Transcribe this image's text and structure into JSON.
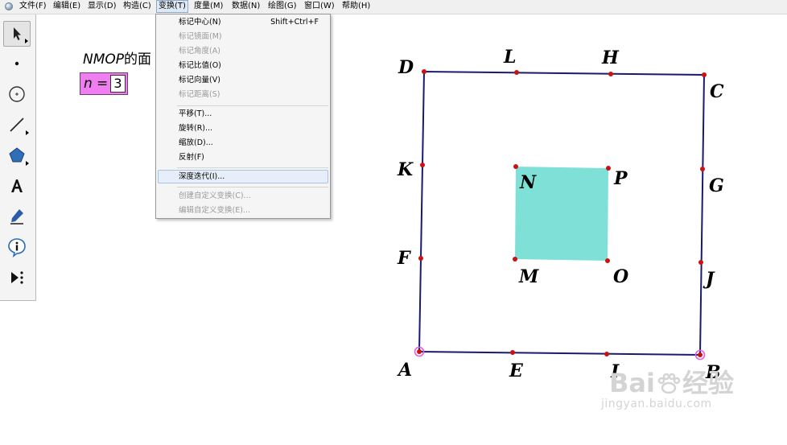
{
  "menubar": {
    "items": [
      {
        "label": "文件(F)"
      },
      {
        "label": "编辑(E)"
      },
      {
        "label": "显示(D)"
      },
      {
        "label": "构造(C)"
      },
      {
        "label": "变换(T)"
      },
      {
        "label": "度量(M)"
      },
      {
        "label": "数据(N)"
      },
      {
        "label": "绘图(G)"
      },
      {
        "label": "窗口(W)"
      },
      {
        "label": "帮助(H)"
      }
    ],
    "active_index": 4
  },
  "toolbar": {
    "tools": [
      "arrow-select-icon",
      "point-tool-icon",
      "compass-tool-icon",
      "straightedge-tool-icon",
      "polygon-tool-icon",
      "text-tool-icon",
      "marker-tool-icon",
      "information-tool-icon",
      "custom-tool-icon"
    ]
  },
  "transform_menu": {
    "items": [
      {
        "label": "标记中心(N)",
        "shortcut": "Shift+Ctrl+F",
        "enabled": true
      },
      {
        "label": "标记镜面(M)",
        "enabled": false
      },
      {
        "label": "标记角度(A)",
        "enabled": false
      },
      {
        "label": "标记比值(O)",
        "enabled": true
      },
      {
        "label": "标记向量(V)",
        "enabled": true
      },
      {
        "label": "标记距离(S)",
        "enabled": false
      },
      {
        "label": "平移(T)...",
        "enabled": true
      },
      {
        "label": "旋转(R)...",
        "enabled": true
      },
      {
        "label": "缩放(D)...",
        "enabled": true
      },
      {
        "label": "反射(F)",
        "enabled": true
      },
      {
        "label": "深度迭代(I)...",
        "enabled": true,
        "highlighted": true
      },
      {
        "label": "创建自定义变换(C)...",
        "enabled": false
      },
      {
        "label": "编辑自定义变换(E)...",
        "enabled": false
      }
    ]
  },
  "canvas": {
    "area_label_italic": "NMOP",
    "area_label_rest": "的面",
    "parameter": {
      "name": "n",
      "equals": "=",
      "value": "3"
    },
    "points": {
      "A": "A",
      "B": "B",
      "C": "C",
      "D": "D",
      "E": "E",
      "F": "F",
      "G": "G",
      "H": "H",
      "I": "I",
      "J": "J",
      "K": "K",
      "L": "L",
      "M": "M",
      "N": "N",
      "O": "O",
      "P": "P"
    },
    "colors": {
      "outer_square": "#1a1a6e",
      "inner_square_fill": "#7fe0d8",
      "point": "#cc1111",
      "selected_point_ring": "#e060e0",
      "parameter_bg": "#f07ef0"
    }
  },
  "watermark": {
    "line1": "Bai",
    "line1b": "经验",
    "line2": "jingyan.baidu.com"
  }
}
